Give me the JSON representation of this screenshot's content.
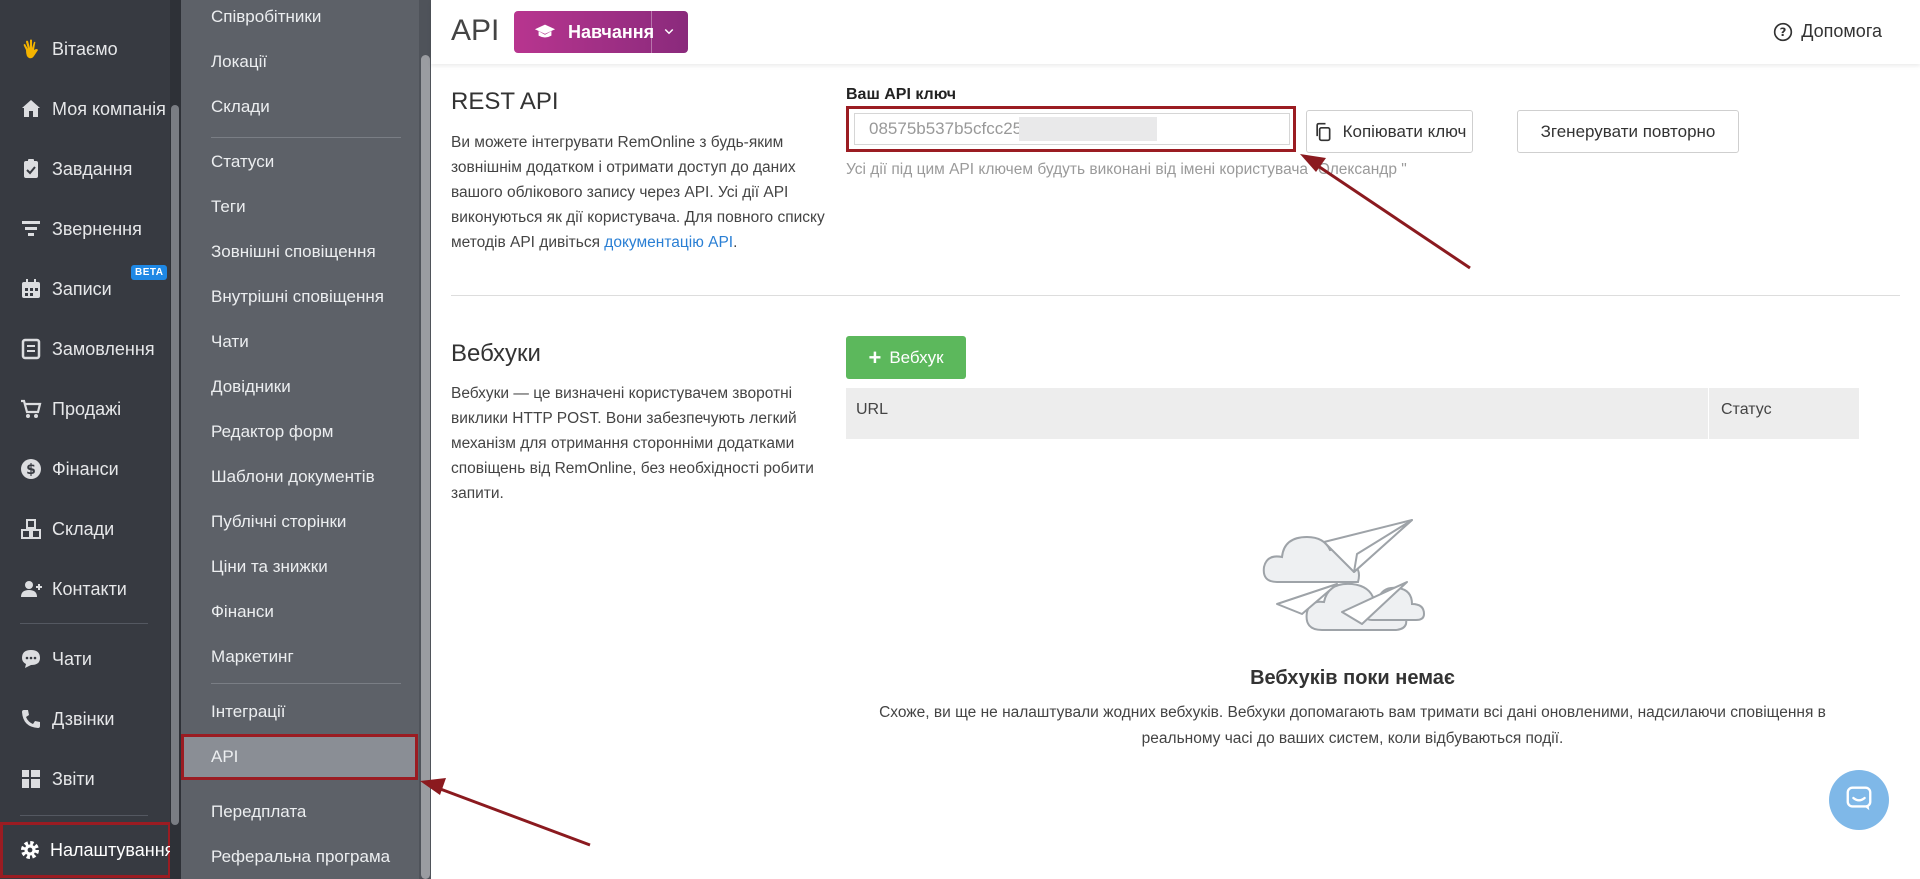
{
  "nav": {
    "items": [
      {
        "label": "Вітаємо",
        "icon": "wave-hand-icon"
      },
      {
        "label": "Моя компанія",
        "icon": "home-icon"
      },
      {
        "label": "Завдання",
        "icon": "clipboard-check-icon"
      },
      {
        "label": "Звернення",
        "icon": "funnel-icon"
      },
      {
        "label": "Записи",
        "icon": "calendar-icon",
        "badge": "BETA"
      },
      {
        "label": "Замовлення",
        "icon": "order-icon"
      },
      {
        "label": "Продажі",
        "icon": "cart-icon"
      },
      {
        "label": "Фінанси",
        "icon": "dollar-icon"
      },
      {
        "label": "Склади",
        "icon": "boxes-icon"
      },
      {
        "label": "Контакти",
        "icon": "users-icon"
      },
      {
        "label": "Чати",
        "icon": "chat-icon"
      },
      {
        "label": "Дзвінки",
        "icon": "phone-icon"
      },
      {
        "label": "Звіти",
        "icon": "grid-icon"
      },
      {
        "label": "Налаштування",
        "icon": "gear-icon"
      }
    ]
  },
  "subnav": {
    "items": [
      {
        "label": "Співробітники"
      },
      {
        "label": "Локації"
      },
      {
        "label": "Склади"
      },
      {
        "label": "Статуси"
      },
      {
        "label": "Теги"
      },
      {
        "label": "Зовнішні сповіщення"
      },
      {
        "label": "Внутрішні сповіщення"
      },
      {
        "label": "Чати"
      },
      {
        "label": "Довідники"
      },
      {
        "label": "Редактор форм"
      },
      {
        "label": "Шаблони документів"
      },
      {
        "label": "Публічні сторінки"
      },
      {
        "label": "Ціни та знижки"
      },
      {
        "label": "Фінанси"
      },
      {
        "label": "Маркетинг"
      },
      {
        "label": "Інтеграції"
      },
      {
        "label": "API"
      },
      {
        "label": "Передплата"
      },
      {
        "label": "Реферальна програма"
      }
    ]
  },
  "header": {
    "title": "API",
    "learn_label": "Навчання",
    "help_label": "Допомога"
  },
  "rest": {
    "title": "REST API",
    "desc": "Ви можете інтегрувати RemOnline з будь-яким зовнішнім додатком і отримати доступ до даних вашого облікового запису через API. Усі дії API виконуються як дії користувача. Для повного списку методів API дивіться",
    "doc_link": "документацію API",
    "desc_end": ".",
    "key_label": "Ваш API ключ",
    "key_value": "08575b537b5cfcc25",
    "copy_label": "Копіювати ключ",
    "regen_label": "Згенерувати повторно",
    "key_note": "Усі дії під цим API ключем будуть виконані від імені користувача \"Олександр \""
  },
  "webhooks": {
    "title": "Вебхуки",
    "desc": "Вебхуки — це визначені користувачем зворотні виклики HTTP POST. Вони забезпечують легкий механізм для отримання сторонніми додатками сповіщень від RemOnline, без необхідності робити запити.",
    "add_label": "Вебхук",
    "columns": [
      "URL",
      "Статус"
    ],
    "empty_title": "Вебхуків поки немає",
    "empty_text": "Схоже, ви ще не налаштували жодних вебхуків. Вебхуки допомагають вам тримати всі дані оновленими, надсилаючи сповіщення в реальному часі до ваших систем, коли відбуваються події."
  },
  "colors": {
    "nav_bg": "#373a41",
    "subnav_bg": "#5d6168",
    "accent_purple": "#b8358f",
    "green": "#5cb85c",
    "highlight_red": "#9b1c22",
    "link_blue": "#2a7fd4"
  }
}
